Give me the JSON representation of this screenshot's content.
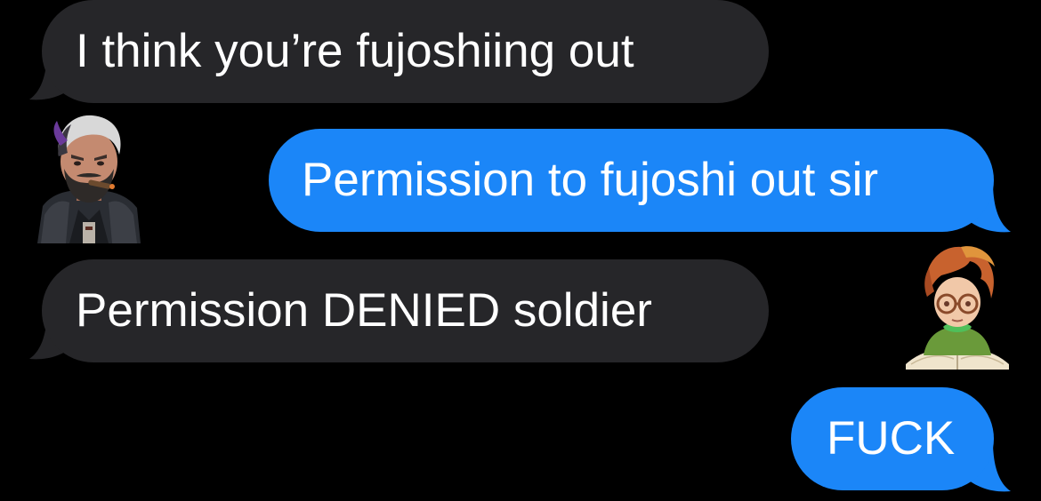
{
  "conversation": {
    "messages": [
      {
        "direction": "incoming",
        "text": "I think you’re fujoshiing out"
      },
      {
        "direction": "outgoing",
        "text": "Permission to fujoshi out sir"
      },
      {
        "direction": "incoming",
        "text": "Permission DENIED soldier"
      },
      {
        "direction": "outgoing",
        "text": "FUCK"
      }
    ]
  },
  "stickers": [
    {
      "name": "bearded-commander-sticker",
      "description_icon": "cartoon-bearded-man-with-cigar"
    },
    {
      "name": "red-haired-reader-sticker",
      "description_icon": "cartoon-girl-with-glasses-and-book"
    }
  ],
  "colors": {
    "background": "#000000",
    "incoming_bubble": "#262629",
    "outgoing_bubble": "#1b86f8",
    "text": "#ffffff"
  }
}
